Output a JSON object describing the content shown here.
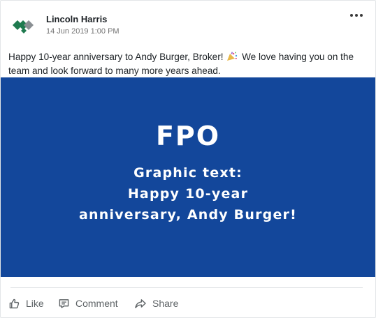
{
  "post": {
    "author_name": "Lincoln Harris",
    "timestamp": "14 Jun 2019 1:00 PM",
    "text_before_emoji": "Happy 10-year anniversary to Andy Burger, Broker!",
    "emoji": "party-popper-icon",
    "text_after_emoji": "We love having you on the team and look forward to many more years ahead."
  },
  "graphic": {
    "title": "FPO",
    "line1": "Graphic text:",
    "line2": "Happy 10-year",
    "line3": "anniversary, Andy Burger!",
    "background_color": "#13479b",
    "text_color": "#ffffff"
  },
  "actions": {
    "like_label": "Like",
    "comment_label": "Comment",
    "share_label": "Share"
  },
  "colors": {
    "logo_green": "#1f7a4f",
    "logo_gray": "#8a8f93",
    "action_gray": "#5e6366"
  }
}
